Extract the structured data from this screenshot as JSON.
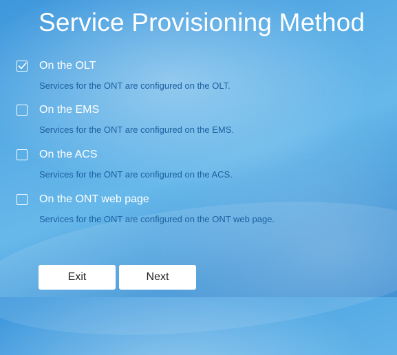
{
  "page": {
    "title": "Service Provisioning Method"
  },
  "options": [
    {
      "label": "On the OLT",
      "description": "Services for the ONT are configured on the OLT.",
      "checked": true
    },
    {
      "label": "On the EMS",
      "description": "Services for the ONT are configured on the EMS.",
      "checked": false
    },
    {
      "label": "On the ACS",
      "description": "Services for the ONT are configured on the ACS.",
      "checked": false
    },
    {
      "label": "On the ONT web page",
      "description": "Services for the ONT are configured on the ONT web page.",
      "checked": false
    }
  ],
  "buttons": {
    "exit_label": "Exit",
    "next_label": "Next"
  },
  "colors": {
    "background": "#4ea6e0",
    "description_text": "#1d5fa0",
    "button_bg": "#ffffff"
  },
  "icons": {
    "checkbox_checked": "check-icon"
  }
}
